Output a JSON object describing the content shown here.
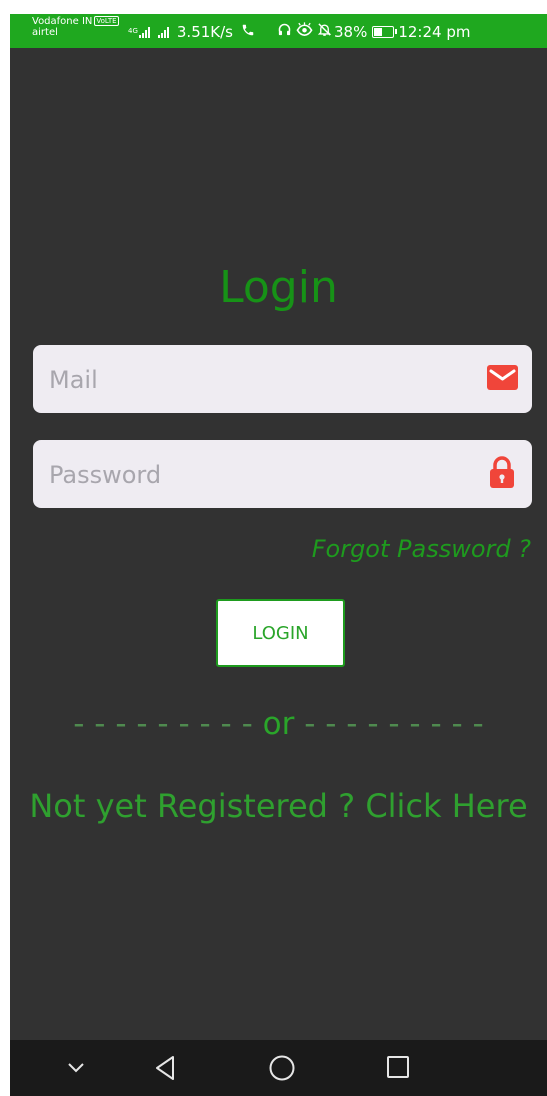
{
  "status_bar": {
    "carrier_primary": "Vodafone IN",
    "volte_badge": "VoLTE",
    "carrier_secondary": "airtel",
    "network_type": "4G",
    "speed": "3.51K/s",
    "battery": "38%",
    "time": "12:24 pm"
  },
  "login_form": {
    "title": "Login",
    "mail_placeholder": "Mail",
    "password_placeholder": "Password",
    "forgot_password": "Forgot Password ?",
    "login_button": "LOGIN",
    "divider_dashes_left": "- - - - - - - - -",
    "divider_text": "or",
    "divider_dashes_right": "- - - - - - - - -",
    "register_link": "Not yet Registered ? Click Here"
  },
  "colors": {
    "status_bar": "#1fa81f",
    "background": "#323232",
    "accent_green": "#179217",
    "field_bg": "#efecf2",
    "icon_red": "#f0453a"
  },
  "icons": {
    "mail": "mail-icon",
    "password": "lock-icon",
    "nav": [
      "chevron-down-icon",
      "back-icon",
      "home-icon",
      "recents-icon"
    ]
  }
}
